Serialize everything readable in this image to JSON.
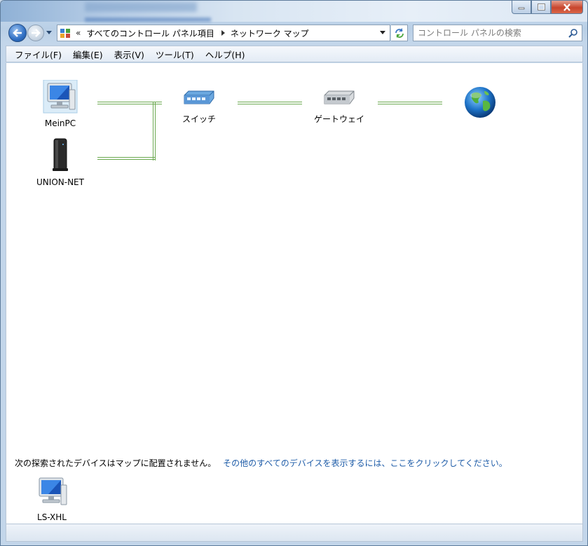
{
  "window": {
    "caption_buttons": [
      "minimize-icon",
      "maximize-icon",
      "close-icon"
    ]
  },
  "navbar": {
    "breadcrumb_chevron": "«",
    "breadcrumb": [
      "すべてのコントロール パネル項目",
      "ネットワーク マップ"
    ],
    "search_placeholder": "コントロール パネルの検索"
  },
  "menu": {
    "items": [
      "ファイル(F)",
      "編集(E)",
      "表示(V)",
      "ツール(T)",
      "ヘルプ(H)"
    ]
  },
  "map": {
    "nodes": [
      {
        "label": "MeinPC",
        "icon": "computer-icon"
      },
      {
        "label": "UNION-NET",
        "icon": "server-icon"
      },
      {
        "label": "スイッチ",
        "icon": "switch-icon"
      },
      {
        "label": "ゲートウェイ",
        "icon": "gateway-icon"
      },
      {
        "label": "",
        "icon": "internet-globe-icon"
      }
    ]
  },
  "unplaced": {
    "message": "次の探索されたデバイスはマップに配置されません。",
    "link": "その他のすべてのデバイスを表示するには、ここをクリックしてください。",
    "devices": [
      {
        "label": "LS-XHL",
        "icon": "computer-icon"
      }
    ]
  },
  "colors": {
    "link": "#1e5ca8",
    "connector": "#6aa84f",
    "close_button": "#c8452d"
  }
}
